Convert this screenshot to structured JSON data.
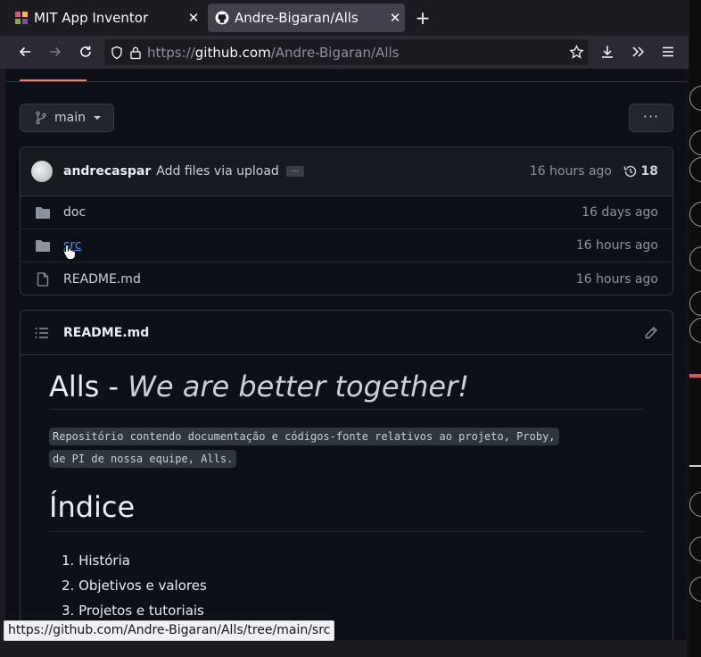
{
  "browser": {
    "tabs": [
      {
        "title": "MIT App Inventor",
        "active": false,
        "icon": "mit-app-inventor-favicon"
      },
      {
        "title": "Andre-Bigaran/Alls",
        "active": true,
        "icon": "github-favicon"
      }
    ],
    "url_prefix": "https://",
    "url_domain": "github.com",
    "url_path": "/Andre-Bigaran/Alls",
    "status_url": "https://github.com/Andre-Bigaran/Alls/tree/main/src"
  },
  "repo": {
    "branch": "main",
    "more_label": "···",
    "commit": {
      "author": "andrecaspar",
      "message": "Add files via upload",
      "ellipsis": "...",
      "time": "16 hours ago",
      "count": "18"
    },
    "files": [
      {
        "type": "folder",
        "name": "doc",
        "time": "16 days ago"
      },
      {
        "type": "folder",
        "name": "src",
        "time": "16 hours ago"
      },
      {
        "type": "file",
        "name": "README.md",
        "time": "16 hours ago"
      }
    ]
  },
  "readme": {
    "header": "README.md",
    "title_plain": "Alls - ",
    "title_em": "We are better together!",
    "code_line1": "Repositório contendo documentação e códigos-fonte relativos ao projeto, Proby,",
    "code_line2": "de PI de nossa equipe, Alls.",
    "index_heading": "Índice",
    "index_items": [
      "1. História",
      "2. Objetivos e valores",
      "3. Projetos e tutoriais"
    ]
  },
  "colors": {
    "accent_underline": "#f78166",
    "link": "#4493f8",
    "bg": "#0d1117"
  }
}
